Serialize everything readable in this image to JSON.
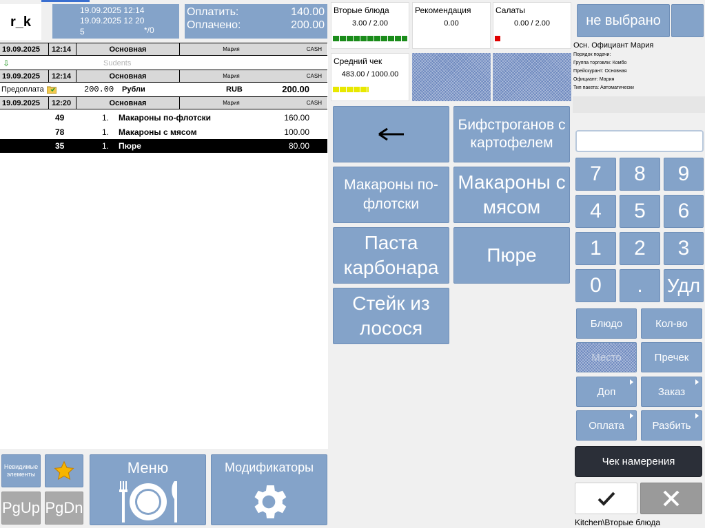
{
  "brand": "r_k",
  "info": {
    "line1": "19.09.2025 12:14",
    "line2": "19.09.2025 12 20",
    "line3": "5",
    "line3b": "*/0",
    "pay_label": "Оплатить:",
    "pay_value": "140.00",
    "paid_label": "Оплачено:",
    "paid_value": "200.00"
  },
  "order": {
    "h1": {
      "date": "19.09.2025",
      "time": "12:14",
      "type": "Основная",
      "waiter": "Мария",
      "cur": "CASH"
    },
    "guest": "Sudents",
    "h2": {
      "date": "19.09.2025",
      "time": "12:14",
      "type": "Основная",
      "waiter": "Мария",
      "cur": "CASH"
    },
    "prepay": {
      "label": "Предоплата",
      "amount": "200.00",
      "currency": "Рубли",
      "code": "RUB",
      "total": "200.00"
    },
    "h3": {
      "date": "19.09.2025",
      "time": "12:20",
      "type": "Основная",
      "waiter": "Мария",
      "cur": "CASH"
    },
    "items": [
      {
        "code": "49",
        "qty": "1.",
        "name": "Макароны по-флотски",
        "price": "160.00"
      },
      {
        "code": "78",
        "qty": "1.",
        "name": "Макароны с мясом",
        "price": "100.00"
      },
      {
        "code": "35",
        "qty": "1.",
        "name": "Пюре",
        "price": "80.00"
      }
    ]
  },
  "stats": [
    {
      "title": "Вторые блюда",
      "value": "3.00 / 2.00",
      "bar_color": "#1a8c1a",
      "fill": 1.0
    },
    {
      "title": "Рекомендация",
      "value": "0.00"
    },
    {
      "title": "Салаты",
      "value": "0.00 / 2.00",
      "bar_color": "#e00000",
      "fill": 0.0
    },
    {
      "title": "Средний чек",
      "value": "483.00 / 1000.00",
      "bar_color": "#e8e800",
      "fill": 0.48
    }
  ],
  "menu_buttons": {
    "back": "←",
    "b1": "Бифстроганов с картофелем",
    "b2": "Макароны по-флотски",
    "b3": "Макароны с мясом",
    "b4": "Паста карбонара",
    "b5": "Пюре",
    "b6": "Стейк из лосося"
  },
  "right": {
    "not_selected": "не выбрано",
    "waiter_line": "Осн. Официант  Мария",
    "details": [
      "Порядок подачи:",
      "Группа торговли: Комбо",
      "Прейскурант: Основная",
      "Официант: Мария",
      "Тип пакета: Автоматически"
    ],
    "keys": [
      "7",
      "8",
      "9",
      "4",
      "5",
      "6",
      "1",
      "2",
      "3",
      "0",
      ".",
      "Удл"
    ],
    "fn": {
      "dish": "Блюдо",
      "qty": "Кол-во",
      "place": "Место",
      "seat": "Пречек",
      "add": "Доп",
      "order": "Заказ",
      "payment": "Оплата",
      "split": "Разбить"
    },
    "intent": "Чек намерения",
    "status": "Kitchen\\Вторые блюда"
  },
  "bottom": {
    "invisible": "Невидимые элементы",
    "pgup": "PgUp",
    "pgdn": "PgDn",
    "menu": "Меню",
    "mods": "Модификаторы"
  },
  "colors": {
    "accent": "#84a3c9",
    "dark": "#2b2f38"
  }
}
